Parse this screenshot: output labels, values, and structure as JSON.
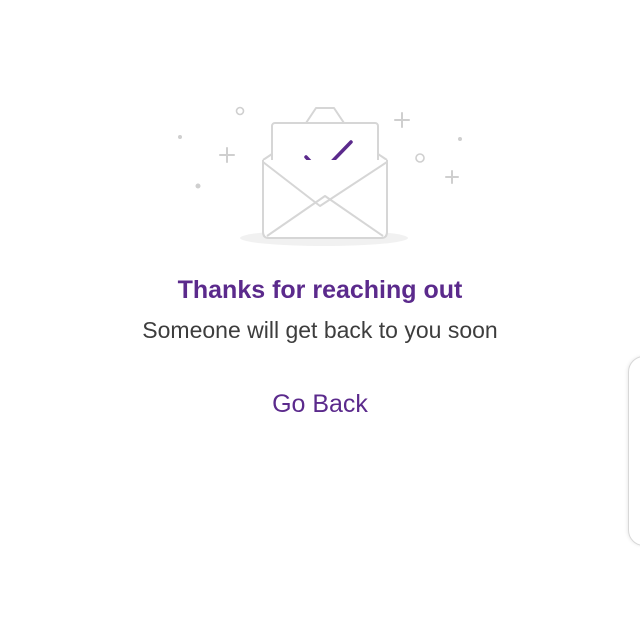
{
  "illustration": {
    "icon": "envelope-check-icon",
    "accent_color": "#5b2a8c",
    "line_color": "#d6d6d6"
  },
  "message": {
    "title": "Thanks for reaching out",
    "subtitle": "Someone will get back to you soon"
  },
  "actions": {
    "go_back_label": "Go Back"
  },
  "colors": {
    "primary": "#5b2a8c",
    "text": "#3d3d3d",
    "background": "#ffffff"
  }
}
